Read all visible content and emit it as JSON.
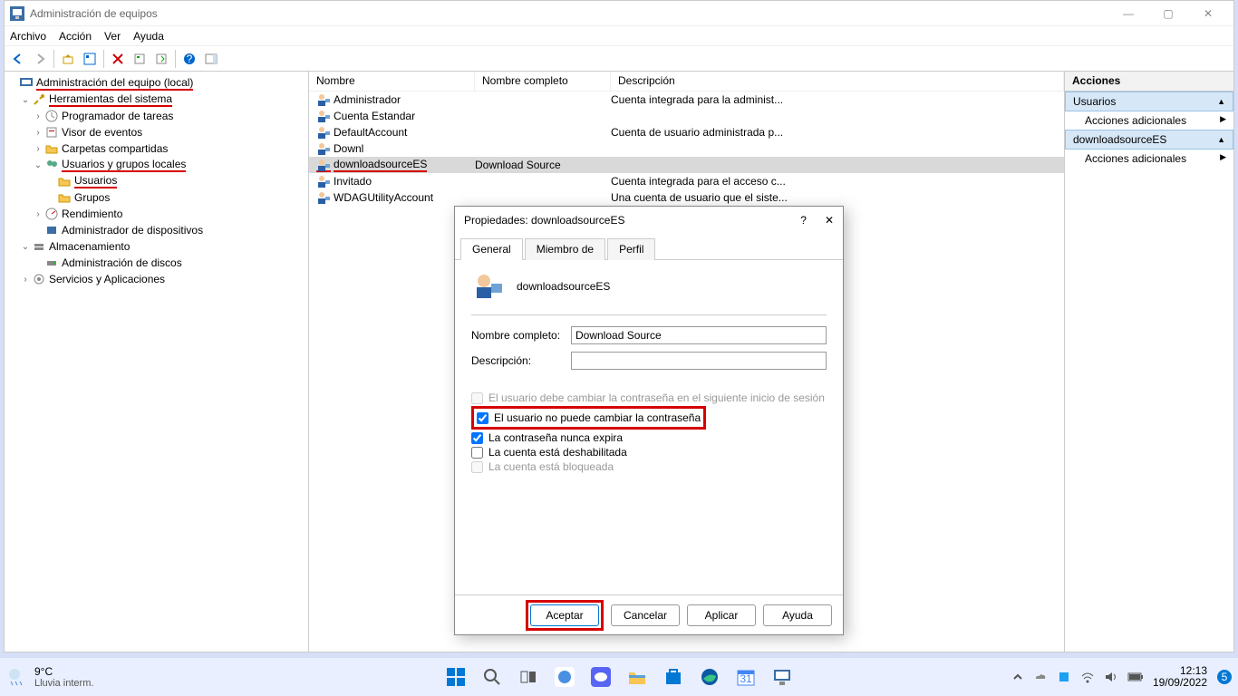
{
  "window": {
    "title": "Administración de equipos",
    "menu": [
      "Archivo",
      "Acción",
      "Ver",
      "Ayuda"
    ]
  },
  "tree": {
    "root": "Administración del equipo (local)",
    "sys_tools": "Herramientas del sistema",
    "task_sched": "Programador de tareas",
    "event_viewer": "Visor de eventos",
    "shared": "Carpetas compartidas",
    "users_groups": "Usuarios y grupos locales",
    "users": "Usuarios",
    "groups": "Grupos",
    "perf": "Rendimiento",
    "devmgr": "Administrador de dispositivos",
    "storage": "Almacenamiento",
    "diskmgr": "Administración de discos",
    "services": "Servicios y Aplicaciones"
  },
  "list": {
    "cols": {
      "name": "Nombre",
      "fullname": "Nombre completo",
      "desc": "Descripción"
    },
    "rows": [
      {
        "name": "Administrador",
        "full": "",
        "desc": "Cuenta integrada para la administ..."
      },
      {
        "name": "Cuenta Estandar",
        "full": "",
        "desc": ""
      },
      {
        "name": "DefaultAccount",
        "full": "",
        "desc": "Cuenta de usuario administrada p..."
      },
      {
        "name": "Downl",
        "full": "",
        "desc": ""
      },
      {
        "name": "downloadsourceES",
        "full": "Download Source",
        "desc": ""
      },
      {
        "name": "Invitado",
        "full": "",
        "desc": "Cuenta integrada para el acceso c..."
      },
      {
        "name": "WDAGUtilityAccount",
        "full": "",
        "desc": "Una cuenta de usuario que el siste..."
      }
    ]
  },
  "actions": {
    "header": "Acciones",
    "section1": "Usuarios",
    "item1": "Acciones adicionales",
    "section2": "downloadsourceES",
    "item2": "Acciones adicionales"
  },
  "dialog": {
    "title": "Propiedades: downloadsourceES",
    "tabs": {
      "general": "General",
      "member": "Miembro de",
      "profile": "Perfil"
    },
    "username": "downloadsourceES",
    "fullname_label": "Nombre completo:",
    "fullname_value": "Download Source",
    "desc_label": "Descripción:",
    "desc_value": "",
    "ck_mustchange": "El usuario debe cambiar la contraseña en el siguiente inicio de sesión",
    "ck_cannotchange": "El usuario no puede cambiar la contraseña",
    "ck_neverexpire": "La contraseña nunca expira",
    "ck_disabled": "La cuenta está deshabilitada",
    "ck_locked": "La cuenta está bloqueada",
    "btn_ok": "Aceptar",
    "btn_cancel": "Cancelar",
    "btn_apply": "Aplicar",
    "btn_help": "Ayuda"
  },
  "taskbar": {
    "temp": "9°C",
    "weather": "Lluvia interm.",
    "time": "12:13",
    "date": "19/09/2022"
  }
}
